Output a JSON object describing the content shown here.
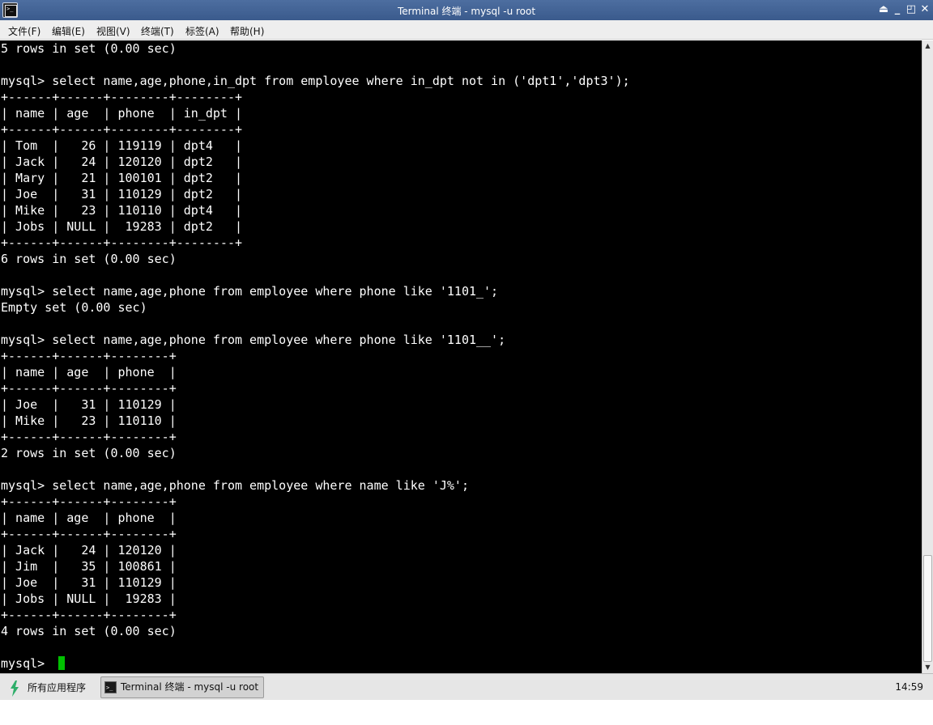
{
  "window": {
    "title": "Terminal 终端 - mysql -u root",
    "controls": [
      "⏏",
      "_",
      "◰",
      "✕"
    ]
  },
  "menu": {
    "items": [
      "文件(F)",
      "编辑(E)",
      "视图(V)",
      "终端(T)",
      "标签(A)",
      "帮助(H)"
    ]
  },
  "terminal": {
    "lines": [
      "5 rows in set (0.00 sec)",
      "",
      "mysql> select name,age,phone,in_dpt from employee where in_dpt not in ('dpt1','dpt3');",
      "+------+------+--------+--------+",
      "| name | age  | phone  | in_dpt |",
      "+------+------+--------+--------+",
      "| Tom  |   26 | 119119 | dpt4   |",
      "| Jack |   24 | 120120 | dpt2   |",
      "| Mary |   21 | 100101 | dpt2   |",
      "| Joe  |   31 | 110129 | dpt2   |",
      "| Mike |   23 | 110110 | dpt4   |",
      "| Jobs | NULL |  19283 | dpt2   |",
      "+------+------+--------+--------+",
      "6 rows in set (0.00 sec)",
      "",
      "mysql> select name,age,phone from employee where phone like '1101_';",
      "Empty set (0.00 sec)",
      "",
      "mysql> select name,age,phone from employee where phone like '1101__';",
      "+------+------+--------+",
      "| name | age  | phone  |",
      "+------+------+--------+",
      "| Joe  |   31 | 110129 |",
      "| Mike |   23 | 110110 |",
      "+------+------+--------+",
      "2 rows in set (0.00 sec)",
      "",
      "mysql> select name,age,phone from employee where name like 'J%';",
      "+------+------+--------+",
      "| name | age  | phone  |",
      "+------+------+--------+",
      "| Jack |   24 | 120120 |",
      "| Jim  |   35 | 100861 |",
      "| Joe  |   31 | 110129 |",
      "| Jobs | NULL |  19283 |",
      "+------+------+--------+",
      "4 rows in set (0.00 sec)",
      "",
      "mysql> "
    ],
    "colors": {
      "background": "#000000",
      "foreground": "#ffffff",
      "cursor": "#00c000"
    }
  },
  "scrollbar": {
    "up_arrow": "▲",
    "down_arrow": "▼"
  },
  "taskbar": {
    "start_label": "所有应用程序",
    "task_label": "Terminal 终端 - mysql -u root",
    "clock": "14:59"
  }
}
